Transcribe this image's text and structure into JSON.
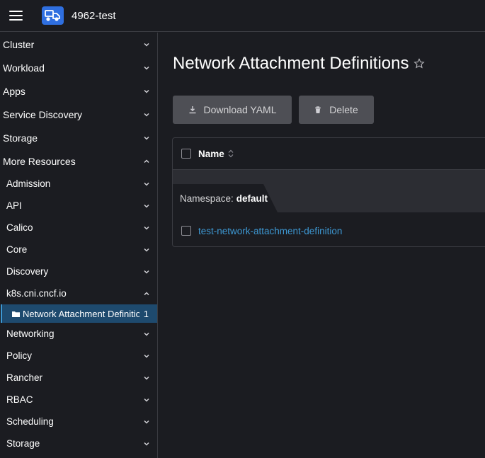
{
  "header": {
    "cluster_name": "4962-test"
  },
  "sidebar": {
    "groups": [
      {
        "label": "Cluster"
      },
      {
        "label": "Workload"
      },
      {
        "label": "Apps"
      },
      {
        "label": "Service Discovery"
      },
      {
        "label": "Storage"
      },
      {
        "label": "More Resources"
      }
    ],
    "more_resources": [
      {
        "label": "Admission"
      },
      {
        "label": "API"
      },
      {
        "label": "Calico"
      },
      {
        "label": "Core"
      },
      {
        "label": "Discovery"
      },
      {
        "label": "k8s.cni.cncf.io"
      }
    ],
    "active_item": {
      "label": "Network Attachment Definitions",
      "count": "1"
    },
    "after_items": [
      {
        "label": "Networking"
      },
      {
        "label": "Policy"
      },
      {
        "label": "Rancher"
      },
      {
        "label": "RBAC"
      },
      {
        "label": "Scheduling"
      },
      {
        "label": "Storage"
      }
    ]
  },
  "main": {
    "title": "Network Attachment Definitions",
    "download_label": "Download YAML",
    "delete_label": "Delete",
    "table": {
      "column_name": "Name",
      "namespace_label": "Namespace:",
      "namespace_value": "default",
      "rows": [
        {
          "name": "test-network-attachment-definition"
        }
      ]
    }
  },
  "colors": {
    "accent": "#3d98d3",
    "active_bg": "#1e4a6e",
    "background": "#1b1c21"
  }
}
